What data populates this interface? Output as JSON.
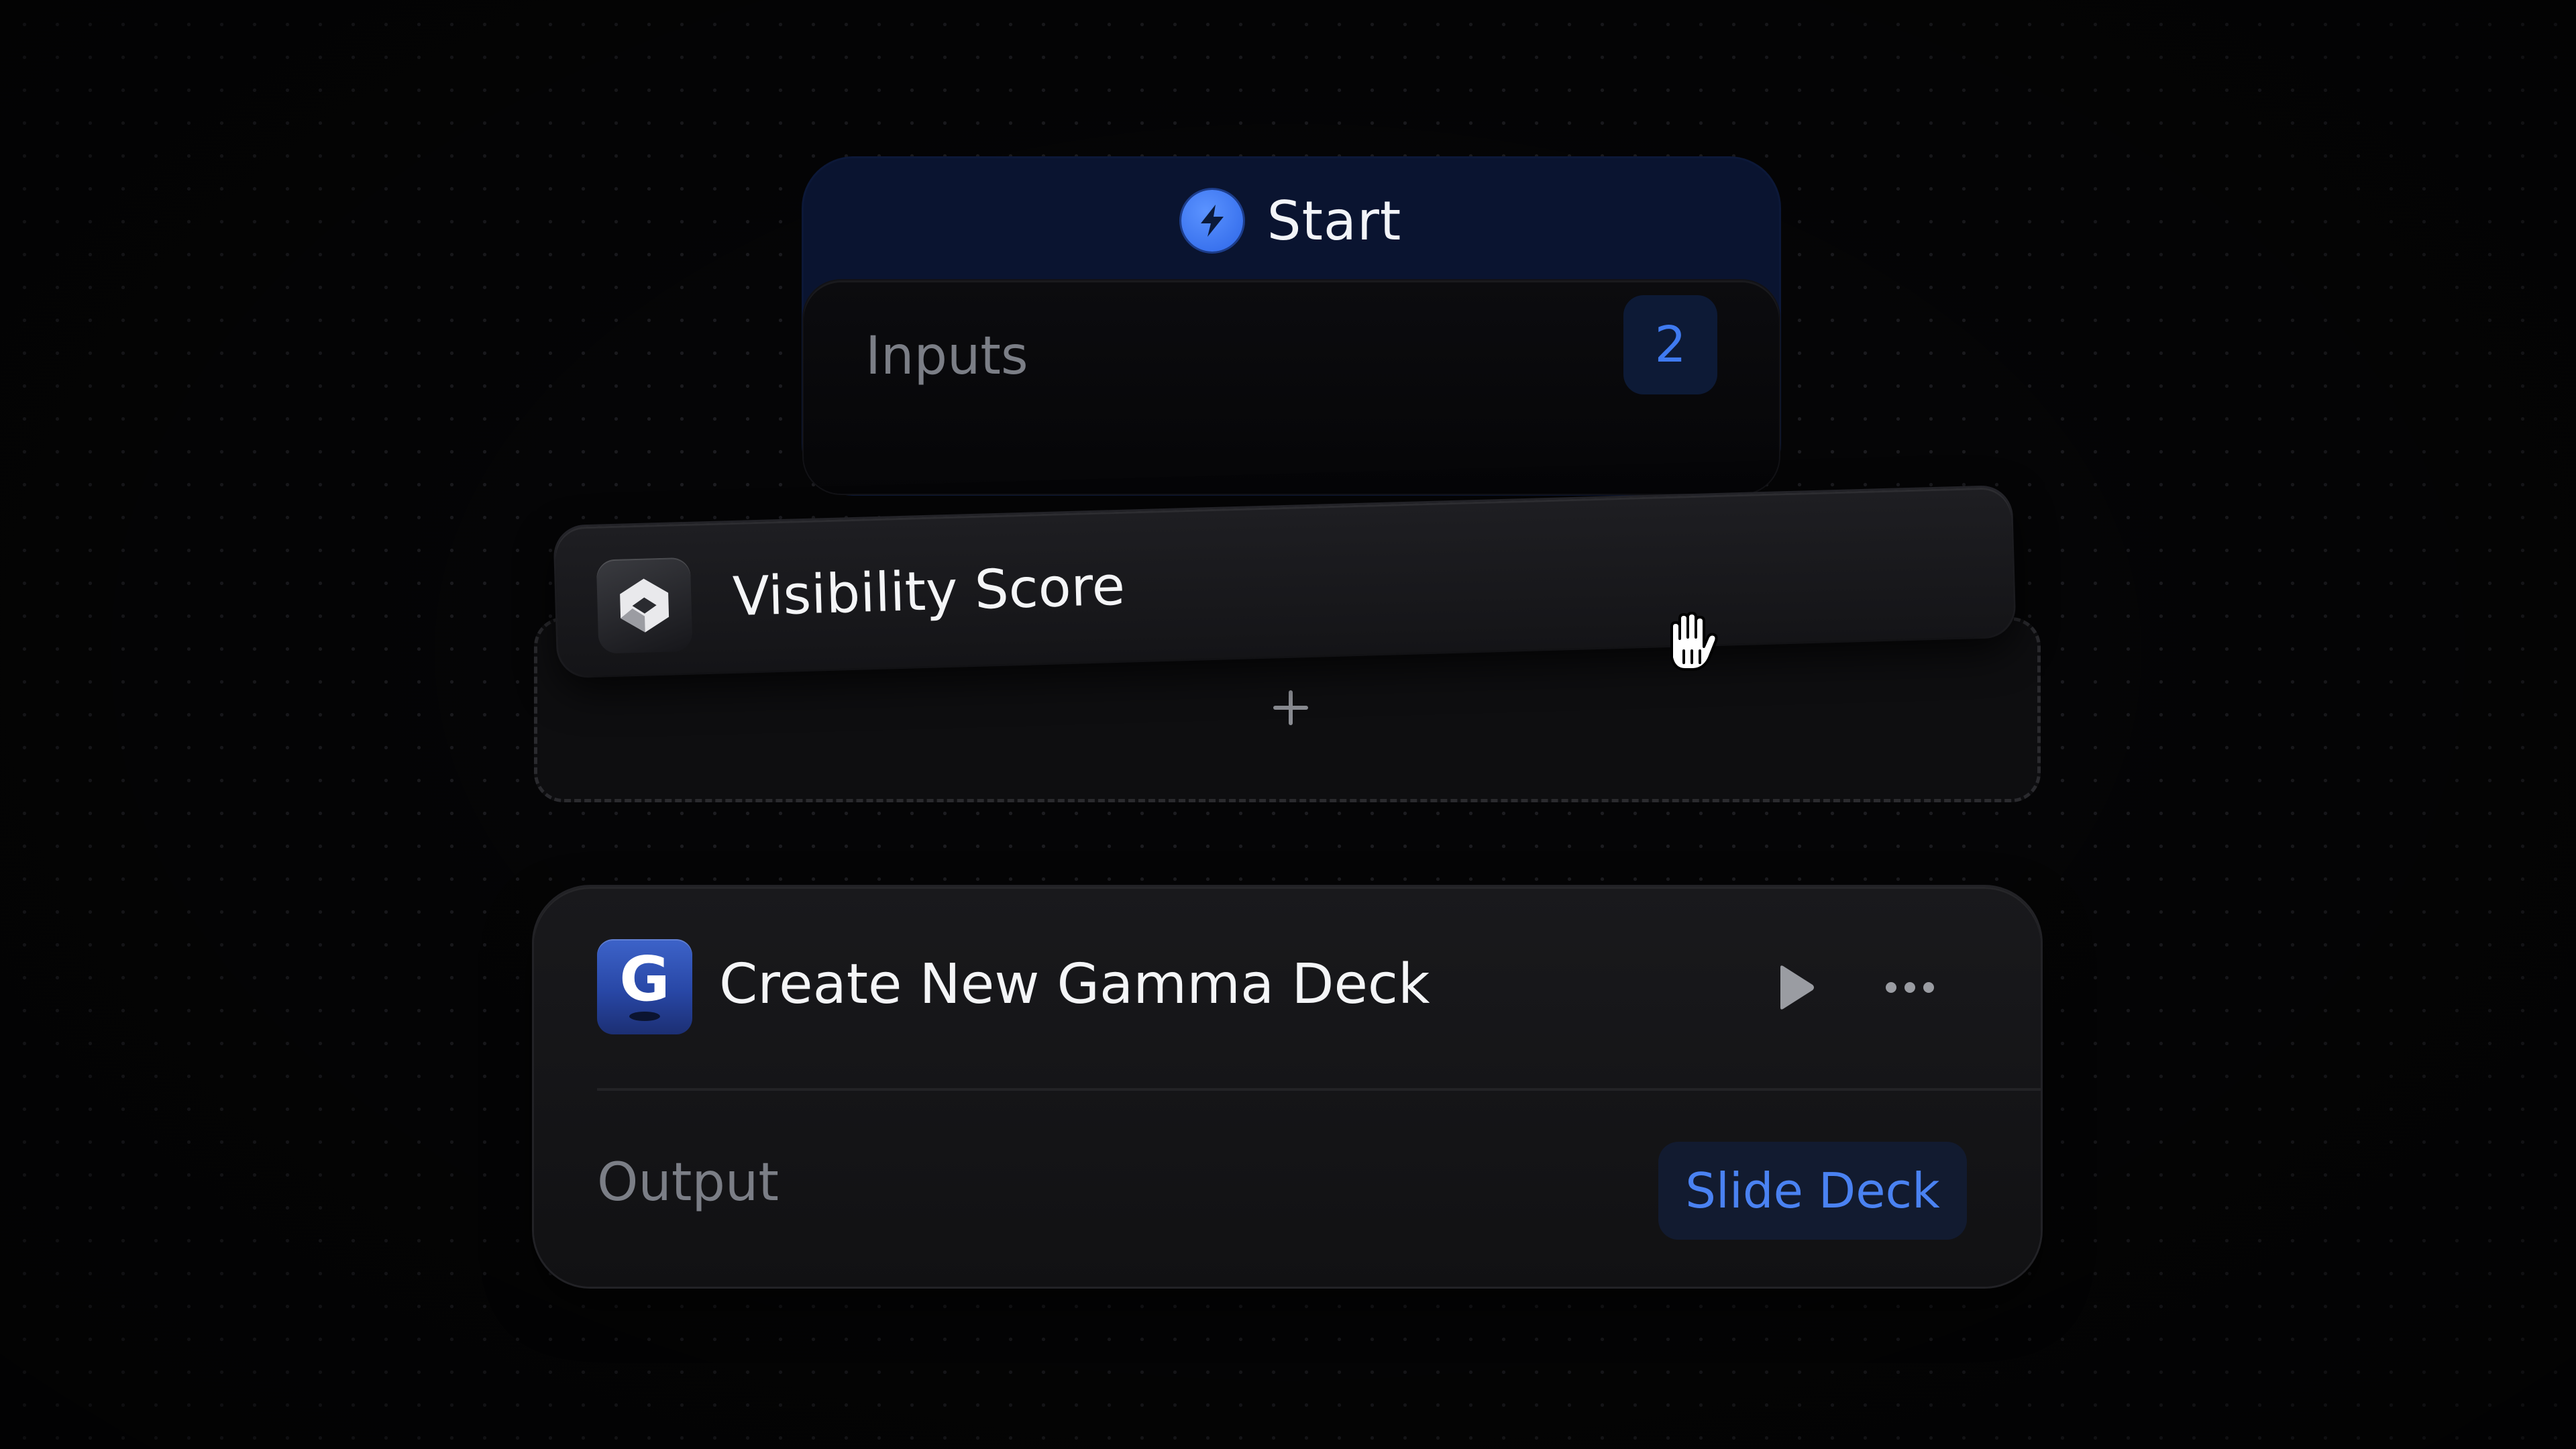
{
  "start_node": {
    "title": "Start",
    "icon": "lightning-bolt-icon",
    "inputs_label": "Inputs",
    "inputs_count": "2"
  },
  "dragged_card": {
    "title": "Visibility Score",
    "icon": "visibility-score-logo"
  },
  "drop_zone": {
    "icon": "plus-icon"
  },
  "gamma_node": {
    "title": "Create New Gamma Deck",
    "icon": "gamma-logo",
    "logo_letter": "G",
    "output_label": "Output",
    "output_value": "Slide Deck"
  },
  "cursor": "grab-hand-icon",
  "colors": {
    "background": "#050506",
    "start_header": "#0a1430",
    "accent_blue": "#4a82f2",
    "bolt_blue": "#3a78ff",
    "muted_text": "#7b7e86",
    "primary_text": "#f4f5f7"
  }
}
